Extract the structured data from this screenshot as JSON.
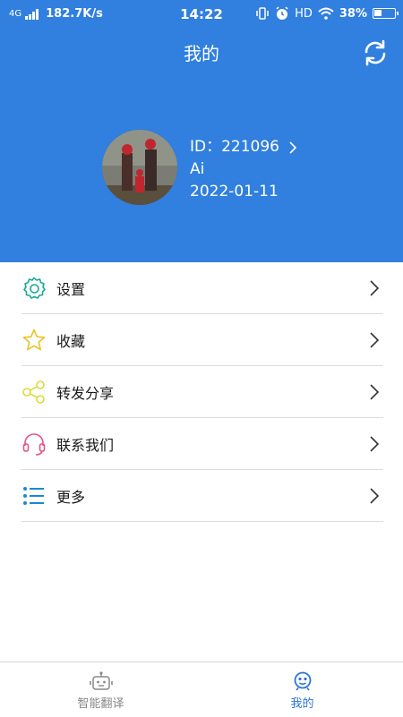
{
  "status_bar": {
    "network": "4G",
    "speed": "182.7K/s",
    "time": "14:22",
    "hd": "HD",
    "battery_percent": "38%",
    "battery_level": 0.38
  },
  "header": {
    "title": "我的",
    "background_color": "#317fde"
  },
  "profile": {
    "id_label": "ID：221096",
    "name": "Ai",
    "date": "2022-01-11"
  },
  "menu": {
    "items": [
      {
        "label": "设置",
        "icon": "gear-icon",
        "color": "#1aa89a"
      },
      {
        "label": "收藏",
        "icon": "star-icon",
        "color": "#e8c32a"
      },
      {
        "label": "转发分享",
        "icon": "share-icon",
        "color": "#d8dc3a"
      },
      {
        "label": "联系我们",
        "icon": "headset-icon",
        "color": "#e0558a"
      },
      {
        "label": "更多",
        "icon": "list-icon",
        "color": "#1e88c8"
      }
    ]
  },
  "tabbar": {
    "tabs": [
      {
        "label": "智能翻译",
        "icon": "robot-icon",
        "active": false
      },
      {
        "label": "我的",
        "icon": "smiley-icon",
        "active": true
      }
    ],
    "active_color": "#2b74d6"
  }
}
